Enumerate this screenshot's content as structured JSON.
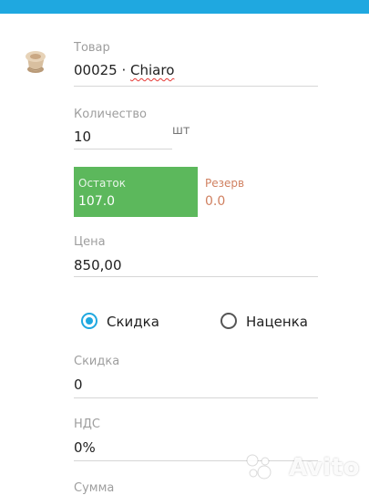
{
  "product": {
    "label": "Товар",
    "value": "00025 · ",
    "name": "Chiaro",
    "icon": "capsule-icon"
  },
  "quantity": {
    "label": "Количество",
    "value": "10",
    "unit": "шт"
  },
  "stock": {
    "label": "Остаток",
    "value": "107.0",
    "color": "#5cb85c"
  },
  "reserve": {
    "label": "Резерв",
    "value": "0.0",
    "color": "#d08060"
  },
  "price": {
    "label": "Цена",
    "value": "850,00"
  },
  "adjustment_mode": {
    "options": [
      {
        "label": "Скидка",
        "selected": true
      },
      {
        "label": "Наценка",
        "selected": false
      }
    ]
  },
  "discount": {
    "label": "Скидка",
    "value": "0"
  },
  "vat": {
    "label": "НДС",
    "value": "0%"
  },
  "sum": {
    "label": "Сумма"
  },
  "watermark": {
    "text": "Avito"
  },
  "colors": {
    "accent": "#1fa8e0"
  }
}
